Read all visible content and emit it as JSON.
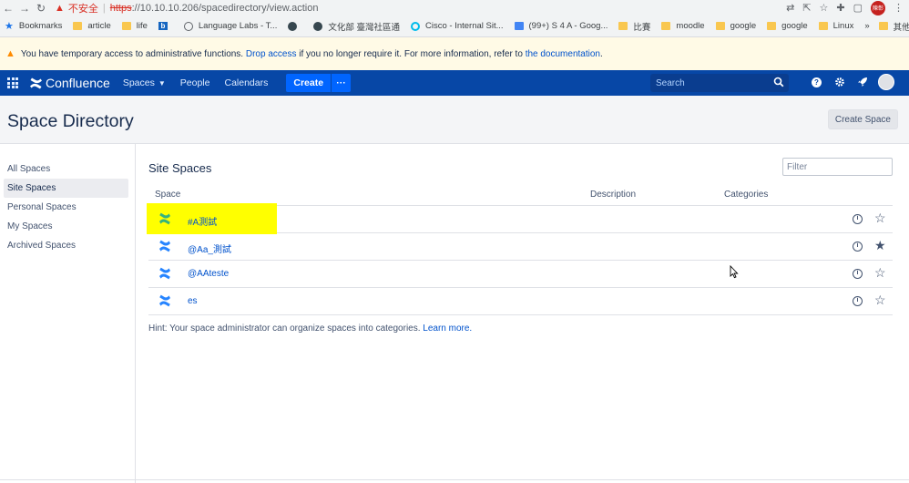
{
  "browser": {
    "back_icon": "←",
    "forward_icon": "→",
    "reload_icon": "↻",
    "warning_icon": "▲",
    "insecure_label": "不安全",
    "url_scheme": "https",
    "url_rest": "://10.10.10.206/spacedirectory/view.action",
    "profile_label": "陳彰"
  },
  "bookmarks": {
    "items": [
      {
        "label": "Bookmarks",
        "icon": "star-icon"
      },
      {
        "label": "article",
        "icon": "folder-icon"
      },
      {
        "label": "life",
        "icon": "folder-icon"
      },
      {
        "label": "",
        "icon": "bing-icon"
      },
      {
        "label": "Language Labs - T...",
        "icon": "globe-icon"
      },
      {
        "label": "",
        "icon": "site-icon"
      },
      {
        "label": "文化部 臺灣社區通",
        "icon": "site-icon"
      },
      {
        "label": "Cisco - Internal Sit...",
        "icon": "cisco-icon"
      },
      {
        "label": "(99+) S 4 A - Goog...",
        "icon": "site-icon"
      },
      {
        "label": "比賽",
        "icon": "folder-icon"
      },
      {
        "label": "moodle",
        "icon": "folder-icon"
      },
      {
        "label": "google",
        "icon": "folder-icon"
      },
      {
        "label": "google",
        "icon": "folder-icon"
      },
      {
        "label": "Linux",
        "icon": "folder-icon"
      }
    ],
    "overflow": "»",
    "other": "其他書籤"
  },
  "notice": {
    "text_before": "You have temporary access to administrative functions.",
    "drop_link": "Drop access",
    "text_middle": "if you no longer require it. For more information, refer to",
    "doc_link": "the documentation",
    "text_end": "."
  },
  "header": {
    "logo_text": "Confluence",
    "spaces": "Spaces",
    "people": "People",
    "calendars": "Calendars",
    "create": "Create",
    "more": "···",
    "search_placeholder": "Search",
    "help": "?"
  },
  "page": {
    "title": "Space Directory",
    "create_space": "Create Space"
  },
  "sidebar": {
    "items": [
      {
        "label": "All Spaces"
      },
      {
        "label": "Site Spaces"
      },
      {
        "label": "Personal Spaces"
      },
      {
        "label": "My Spaces"
      },
      {
        "label": "Archived Spaces"
      }
    ]
  },
  "main": {
    "section_title": "Site Spaces",
    "filter_placeholder": "Filter",
    "columns": {
      "space": "Space",
      "description": "Description",
      "categories": "Categories"
    },
    "rows": [
      {
        "name": "#A測試",
        "icon_color": "#36b37e",
        "starred": false,
        "highlighted": true
      },
      {
        "name": "@Aa_測試",
        "icon_color": "#2684ff",
        "starred": true,
        "highlighted": false
      },
      {
        "name": "@AAteste",
        "icon_color": "#2684ff",
        "starred": false,
        "highlighted": false
      },
      {
        "name": "es",
        "icon_color": "#2684ff",
        "starred": false,
        "highlighted": false
      }
    ],
    "hint_text": "Hint: Your space administrator can organize spaces into categories.",
    "hint_link": "Learn more."
  },
  "colors": {
    "header_bg": "#0747a6",
    "link": "#0052cc",
    "highlight": "#ffff00",
    "notice_bg": "#fffae6"
  }
}
